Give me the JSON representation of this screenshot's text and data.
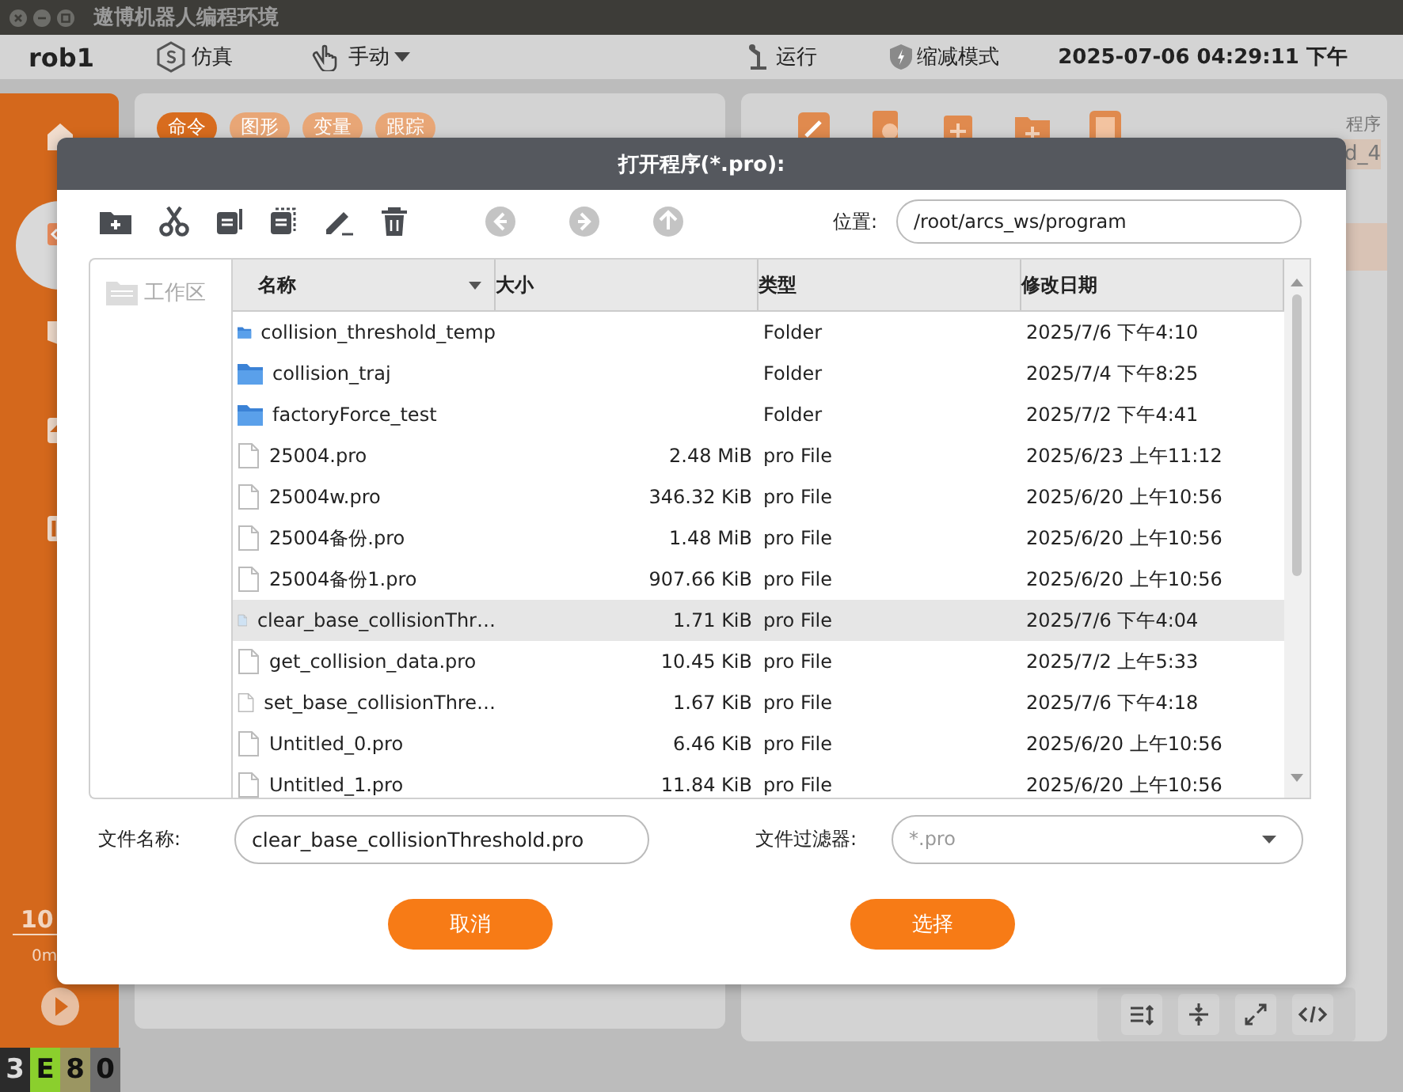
{
  "window": {
    "title": "遨博机器人编程环境"
  },
  "top_bar": {
    "robot": "rob1",
    "mode": "仿真",
    "control": "手动",
    "run": "运行",
    "safety": "缩减模式",
    "datetime": "2025-07-06 04:29:11 下午"
  },
  "sidebar": {
    "items": [
      {
        "selected": false
      },
      {
        "selected": true
      },
      {
        "selected": false
      },
      {
        "selected": false
      },
      {
        "selected": false
      }
    ],
    "speed": "10",
    "speed_unit": "0m"
  },
  "status_cells": [
    {
      "text": "3",
      "color": "#2b2b2b"
    },
    {
      "text": "E",
      "color": "#8bcf2d"
    },
    {
      "text": "8",
      "color": "#9b9662"
    },
    {
      "text": "0",
      "color": "#6e6e6e"
    }
  ],
  "editor_tabs": [
    {
      "label": "命令",
      "selected": true
    },
    {
      "label": "图形",
      "selected": false
    },
    {
      "label": "变量",
      "selected": false
    },
    {
      "label": "跟踪",
      "selected": false
    }
  ],
  "program_panel": {
    "label": "程序",
    "value": "d_4"
  },
  "dialog": {
    "title": "打开程序(*.pro):",
    "nav": [
      {
        "disabled": true
      },
      {
        "disabled": true
      },
      {
        "disabled": true
      }
    ],
    "location_label": "位置:",
    "location_value": "/root/arcs_ws/program",
    "places": [
      {
        "label": "工作区"
      }
    ],
    "columns": [
      {
        "label": "名称",
        "sorted": true
      },
      {
        "label": "大小",
        "sorted": false
      },
      {
        "label": "类型",
        "sorted": false
      },
      {
        "label": "修改日期",
        "sorted": false
      }
    ],
    "rows": [
      {
        "kind": "folder",
        "name": "collision_threshold_temp",
        "size": "",
        "type": "Folder",
        "date": "2025/7/6 下午4:10",
        "selected": false
      },
      {
        "kind": "folder",
        "name": "collision_traj",
        "size": "",
        "type": "Folder",
        "date": "2025/7/4 下午8:25",
        "selected": false
      },
      {
        "kind": "folder",
        "name": "factoryForce_test",
        "size": "",
        "type": "Folder",
        "date": "2025/7/2 下午4:41",
        "selected": false
      },
      {
        "kind": "file",
        "name": "25004.pro",
        "size": "2.48 MiB",
        "type": "pro File",
        "date": "2025/6/23 上午11:12",
        "selected": false
      },
      {
        "kind": "file",
        "name": "25004w.pro",
        "size": "346.32 KiB",
        "type": "pro File",
        "date": "2025/6/20 上午10:56",
        "selected": false
      },
      {
        "kind": "file",
        "name": "25004备份.pro",
        "size": "1.48 MiB",
        "type": "pro File",
        "date": "2025/6/20 上午10:56",
        "selected": false
      },
      {
        "kind": "file",
        "name": "25004备份1.pro",
        "size": "907.66 KiB",
        "type": "pro File",
        "date": "2025/6/20 上午10:56",
        "selected": false
      },
      {
        "kind": "file",
        "name": "clear_base_collisionThr…",
        "size": "1.71 KiB",
        "type": "pro File",
        "date": "2025/7/6 下午4:04",
        "selected": true
      },
      {
        "kind": "file",
        "name": "get_collision_data.pro",
        "size": "10.45 KiB",
        "type": "pro File",
        "date": "2025/7/2 上午5:33",
        "selected": false
      },
      {
        "kind": "file",
        "name": "set_base_collisionThre…",
        "size": "1.67 KiB",
        "type": "pro File",
        "date": "2025/7/6 下午4:18",
        "selected": false
      },
      {
        "kind": "file",
        "name": "Untitled_0.pro",
        "size": "6.46 KiB",
        "type": "pro File",
        "date": "2025/6/20 上午10:56",
        "selected": false
      },
      {
        "kind": "file",
        "name": "Untitled_1.pro",
        "size": "11.84 KiB",
        "type": "pro File",
        "date": "2025/6/20 上午10:56",
        "selected": false
      }
    ],
    "filename_label": "文件名称:",
    "filename_value": "clear_base_collisionThreshold.pro",
    "filter_label": "文件过滤器:",
    "filter_value": "*.pro",
    "buttons": [
      {
        "label": "取消"
      },
      {
        "label": "选择"
      }
    ]
  }
}
